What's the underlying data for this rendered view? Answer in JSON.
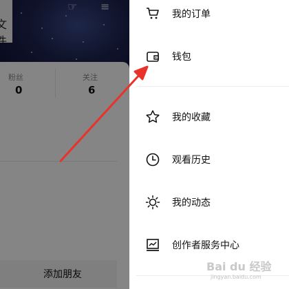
{
  "profile": {
    "top_cut_text": "文件",
    "stats": [
      {
        "label": "粉丝",
        "value": "0"
      },
      {
        "label": "关注",
        "value": "6"
      }
    ],
    "add_friend_label": "添加朋友"
  },
  "drawer": {
    "items": [
      {
        "label": "我的订单",
        "icon": "cart-icon"
      },
      {
        "label": "钱包",
        "icon": "wallet-icon"
      },
      {
        "label": "我的收藏",
        "icon": "star-icon"
      },
      {
        "label": "观看历史",
        "icon": "clock-icon"
      },
      {
        "label": "我的动态",
        "icon": "sun-icon"
      },
      {
        "label": "创作者服务中心",
        "icon": "chart-icon"
      }
    ]
  },
  "annotation": {
    "arrow_color": "#e8322a",
    "target": "钱包"
  },
  "watermark": {
    "text": "Bai du 经验",
    "sub": "jingyan.baidu.com"
  }
}
